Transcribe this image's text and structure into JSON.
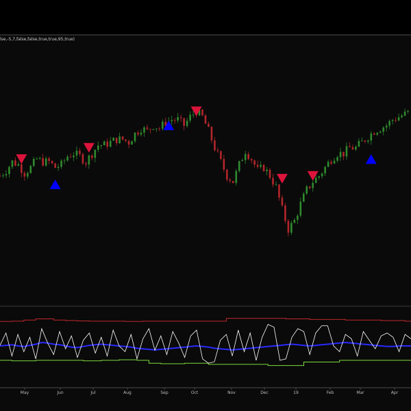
{
  "study_label": "lse,-5,7,false,false,true,true,95,true)",
  "colors": {
    "background": "#0a0a0a",
    "up_candle": "#2e8b2e",
    "down_candle": "#b3262b",
    "buy_marker": "#0000ff",
    "sell_marker": "#dc143c",
    "oscillator_line": "#ffffff",
    "upper_band": "#c0282d",
    "lower_band": "#7cdc3c",
    "middle_line": "#2a2aff",
    "separator": "#4a4a4a"
  },
  "chart_data": [
    {
      "type": "candlestick",
      "x_ticks": [
        "May",
        "Jun",
        "Jul",
        "Aug",
        "Sep",
        "Oct",
        "Nov",
        "Dec",
        "19",
        "Feb",
        "Mar",
        "Apr"
      ],
      "close_series": [
        [
          0,
          52
        ],
        [
          2,
          54
        ],
        [
          4,
          57
        ],
        [
          6,
          56
        ],
        [
          8,
          53
        ],
        [
          10,
          55
        ],
        [
          12,
          58
        ],
        [
          14,
          57
        ],
        [
          16,
          57
        ],
        [
          18,
          55
        ],
        [
          20,
          56
        ],
        [
          22,
          59
        ],
        [
          24,
          60
        ],
        [
          26,
          59
        ],
        [
          28,
          57
        ],
        [
          30,
          60
        ],
        [
          32,
          63
        ],
        [
          34,
          63
        ],
        [
          36,
          64
        ],
        [
          38,
          65
        ],
        [
          40,
          65
        ],
        [
          42,
          64
        ],
        [
          44,
          67
        ],
        [
          46,
          69
        ],
        [
          48,
          68
        ],
        [
          50,
          70
        ],
        [
          52,
          69
        ],
        [
          54,
          71
        ],
        [
          56,
          72
        ],
        [
          58,
          72
        ],
        [
          60,
          70
        ],
        [
          62,
          73
        ],
        [
          64,
          75
        ],
        [
          66,
          73
        ],
        [
          68,
          68
        ],
        [
          70,
          62
        ],
        [
          72,
          57
        ],
        [
          74,
          52
        ],
        [
          76,
          50
        ],
        [
          78,
          56
        ],
        [
          80,
          61
        ],
        [
          82,
          58
        ],
        [
          84,
          54
        ],
        [
          86,
          55
        ],
        [
          88,
          52
        ],
        [
          90,
          48
        ],
        [
          92,
          40
        ],
        [
          94,
          33
        ],
        [
          96,
          36
        ],
        [
          98,
          42
        ],
        [
          100,
          47
        ],
        [
          102,
          50
        ],
        [
          104,
          52
        ],
        [
          106,
          55
        ],
        [
          108,
          58
        ],
        [
          110,
          60
        ],
        [
          112,
          60
        ],
        [
          114,
          62
        ],
        [
          116,
          62
        ],
        [
          118,
          64
        ],
        [
          120,
          66
        ],
        [
          122,
          68
        ],
        [
          124,
          69
        ],
        [
          126,
          70
        ],
        [
          128,
          72
        ],
        [
          130,
          73
        ],
        [
          132,
          74
        ],
        [
          134,
          75
        ]
      ],
      "sell_signals": [
        [
          7,
          58
        ],
        [
          29,
          62
        ],
        [
          64,
          75
        ],
        [
          92,
          51
        ],
        [
          102,
          52
        ]
      ],
      "buy_signals": [
        [
          18,
          49
        ],
        [
          55,
          70
        ],
        [
          121,
          58
        ]
      ]
    },
    {
      "type": "line",
      "x_ticks": [
        "May",
        "Jun",
        "Jul",
        "Aug",
        "Sep",
        "Oct",
        "Nov",
        "Dec",
        "19",
        "Feb",
        "Mar",
        "Apr"
      ],
      "series": [
        {
          "values": [
            2,
            45,
            -35,
            40,
            -20,
            30,
            -45,
            60,
            10,
            -30,
            50,
            -10,
            35,
            -40,
            20,
            45,
            -25,
            30,
            -35,
            55,
            0,
            -20,
            40,
            -45,
            25,
            60,
            -15,
            35,
            -30,
            50,
            10,
            -40,
            35,
            55,
            -45,
            -60,
            -55,
            20,
            40,
            -35,
            55,
            -20,
            45,
            -50,
            30,
            75,
            65,
            -50,
            -45,
            30,
            60,
            50,
            -30,
            45,
            70,
            70,
            0,
            -20,
            40,
            25,
            -35,
            50,
            20,
            -10,
            35,
            45,
            30,
            -20,
            40,
            25
          ]
        },
        {
          "values": [
            85,
            85,
            86,
            86,
            90,
            90,
            94,
            94,
            94,
            90,
            90,
            88,
            88,
            87,
            87,
            86,
            86,
            86,
            86,
            86,
            86,
            85,
            85,
            85,
            86,
            86,
            86,
            86,
            86,
            86,
            86,
            86,
            86,
            86,
            86,
            86,
            86,
            86,
            96,
            96,
            96,
            96,
            96,
            96,
            96,
            96,
            96,
            96,
            94,
            94,
            94,
            94,
            92,
            92,
            92,
            92,
            92,
            92,
            90,
            90,
            90,
            90,
            90,
            90,
            88,
            88,
            88,
            88,
            86,
            86
          ]
        },
        {
          "values": [
            -50,
            -50,
            -52,
            -52,
            -52,
            -52,
            -50,
            -50,
            -50,
            -50,
            -50,
            -50,
            -50,
            -50,
            -52,
            -52,
            -52,
            -50,
            -50,
            -50,
            -48,
            -48,
            -48,
            -50,
            -50,
            -60,
            -60,
            -62,
            -62,
            -62,
            -62,
            -60,
            -60,
            -60,
            -60,
            -64,
            -64,
            -64,
            -64,
            -64,
            -64,
            -64,
            -64,
            -64,
            -64,
            -68,
            -68,
            -68,
            -68,
            -68,
            -68,
            -56,
            -56,
            -56,
            -56,
            -56,
            -56,
            -50,
            -50,
            -50,
            -50,
            -50,
            -50,
            -50,
            -50,
            -50,
            -50,
            -50,
            -50,
            -50
          ]
        },
        {
          "values": [
            0,
            2,
            4,
            0,
            -2,
            2,
            6,
            12,
            10,
            6,
            4,
            0,
            -4,
            -6,
            -2,
            2,
            4,
            6,
            4,
            2,
            0,
            -2,
            -4,
            -8,
            -10,
            -12,
            -14,
            -12,
            -10,
            -8,
            -6,
            -4,
            -2,
            0,
            -2,
            -4,
            -8,
            -10,
            -12,
            -14,
            -12,
            -10,
            -8,
            -6,
            -4,
            -2,
            0,
            2,
            4,
            6,
            4,
            2,
            0,
            2,
            4,
            6,
            8,
            10,
            12,
            10,
            8,
            6,
            4,
            2,
            0,
            -2,
            -2,
            0,
            0,
            0
          ]
        }
      ]
    }
  ]
}
